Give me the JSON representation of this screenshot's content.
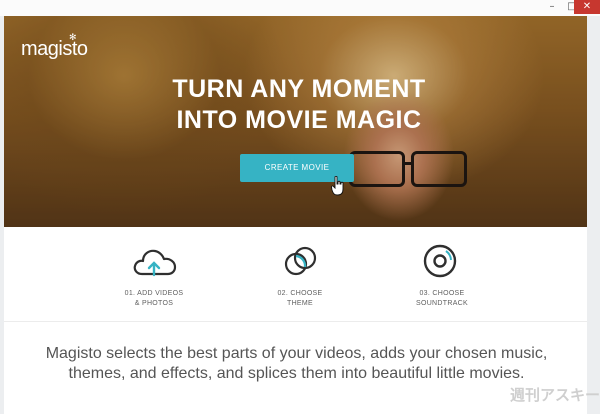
{
  "window": {
    "minimize": "–",
    "maximize": "□",
    "close": "✕"
  },
  "hero": {
    "logo": "magisto",
    "headline_line1": "TURN ANY MOMENT",
    "headline_line2": "INTO MOVIE MAGIC",
    "cta_label": "CREATE MOVIE"
  },
  "steps": [
    {
      "line1": "01. ADD VIDEOS",
      "line2": "& PHOTOS",
      "icon": "cloud-upload-icon"
    },
    {
      "line1": "02. CHOOSE",
      "line2": "THEME",
      "icon": "overlapping-circles-icon"
    },
    {
      "line1": "03. CHOOSE",
      "line2": "SOUNDTRACK",
      "icon": "disc-icon"
    }
  ],
  "description": {
    "line1": "Magisto selects the best parts of your videos, adds your chosen music,",
    "line2": "themes, and effects, and splices them into beautiful little movies."
  },
  "watermark": "週刊アスキー",
  "colors": {
    "accent": "#36b3c4",
    "text": "#555555",
    "icon": "#2f2f2f"
  }
}
